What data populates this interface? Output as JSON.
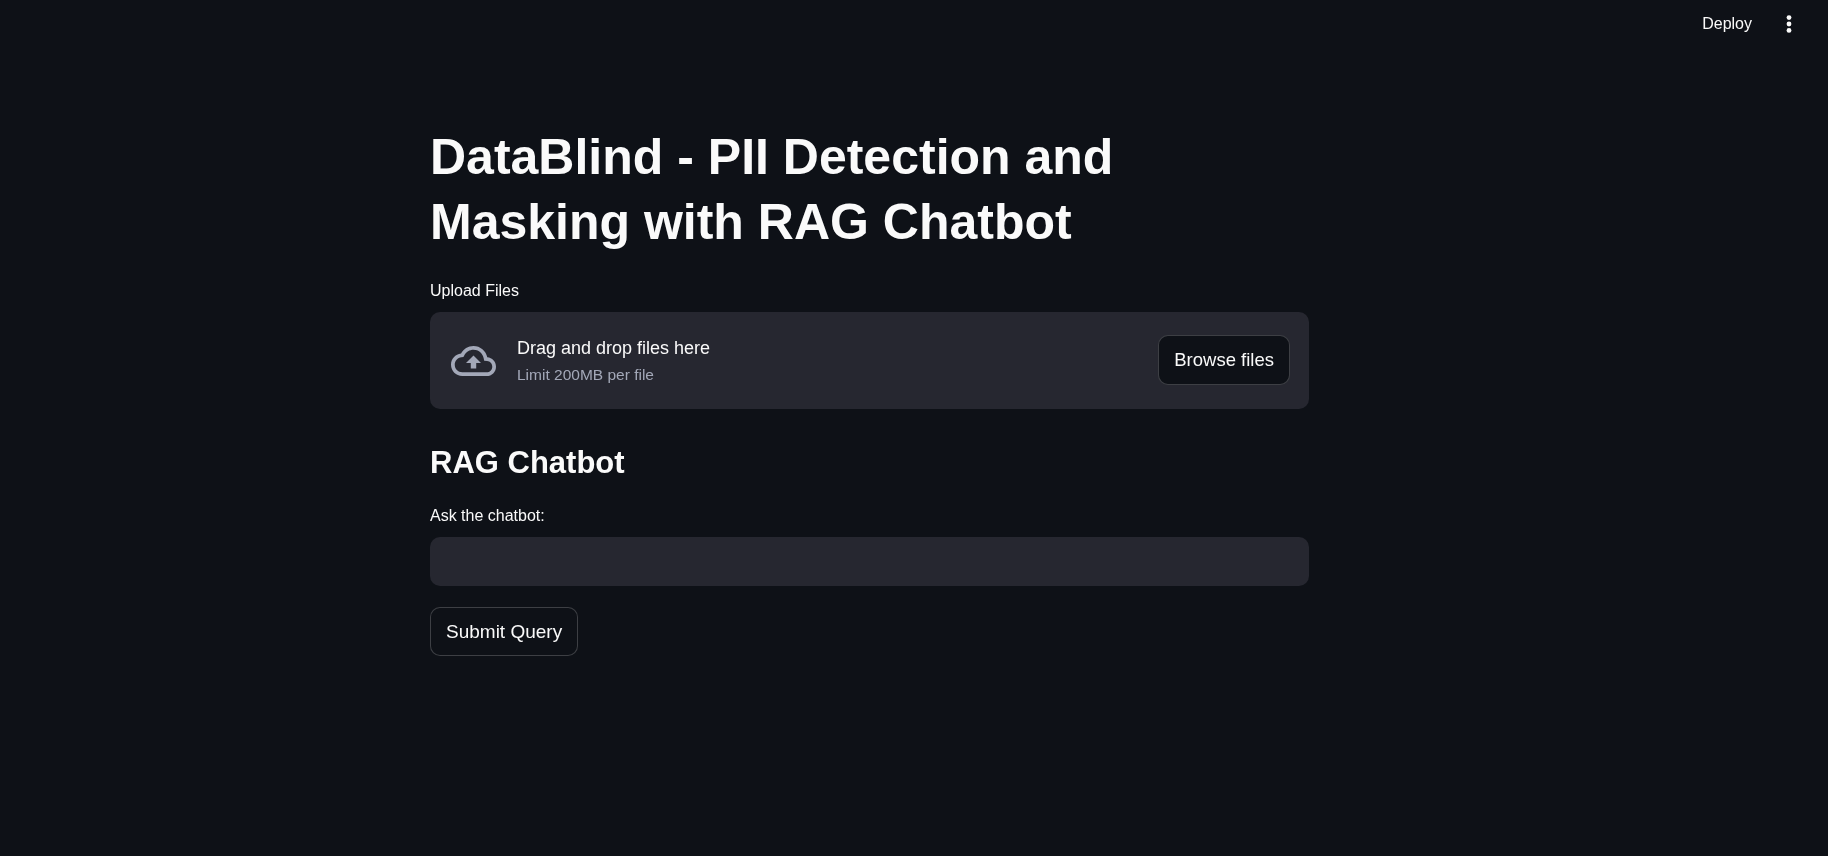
{
  "header": {
    "deploy_button": "Deploy"
  },
  "title": "DataBlind - PII Detection and Masking with RAG Chatbot",
  "uploader": {
    "label": "Upload Files",
    "instructions": "Drag and drop files here",
    "limit": "Limit 200MB per file",
    "browse_button": "Browse files"
  },
  "chatbot": {
    "heading": "RAG Chatbot",
    "query_label": "Ask the chatbot:",
    "submit_button": "Submit Query"
  }
}
